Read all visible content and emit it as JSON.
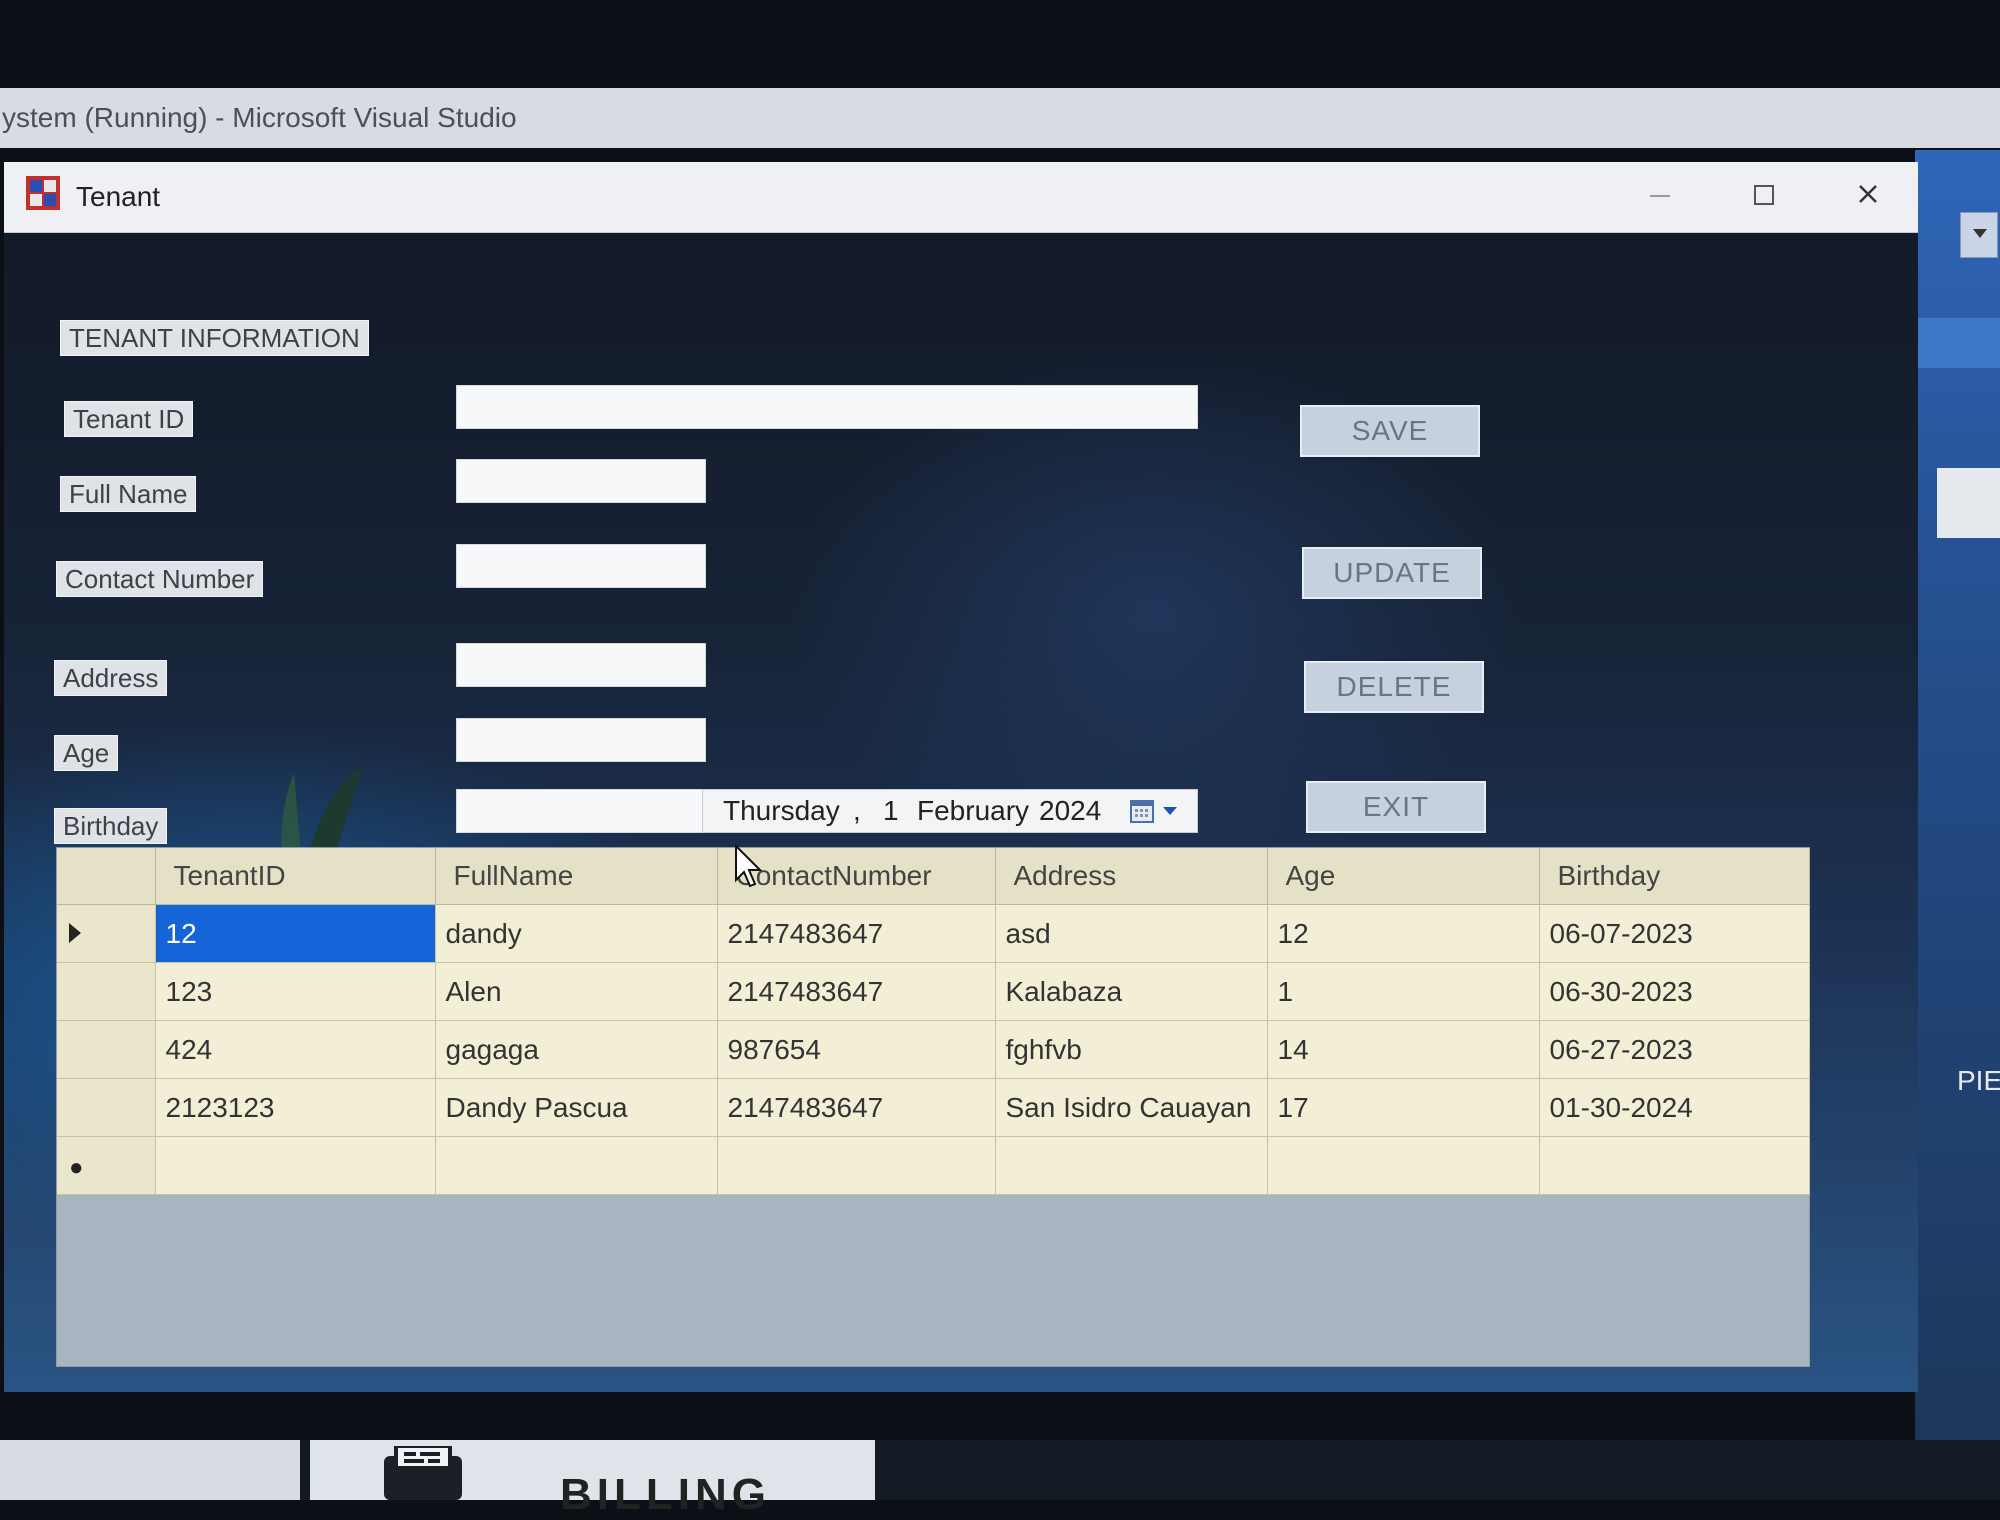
{
  "vs_titlebar": {
    "title": "ystem (Running) - Microsoft Visual Studio"
  },
  "window": {
    "title": "Tenant"
  },
  "form": {
    "section_title": "TENANT INFORMATION",
    "labels": {
      "tenant_id": "Tenant ID",
      "full_name": "Full Name",
      "contact_number": "Contact Number",
      "address": "Address",
      "age": "Age",
      "birthday": "Birthday"
    },
    "values": {
      "tenant_id": "",
      "full_name": "",
      "contact_number": "",
      "address": "",
      "age": "",
      "birthday": ""
    },
    "date_picker": {
      "weekday": "Thursday",
      "separator": ",",
      "day": "1",
      "month": "February",
      "year": "2024"
    }
  },
  "buttons": {
    "save": "SAVE",
    "update": "UPDATE",
    "delete": "DELETE",
    "exit": "EXIT"
  },
  "grid": {
    "columns": [
      "TenantID",
      "FullName",
      "ContactNumber",
      "Address",
      "Age",
      "Birthday"
    ],
    "rows": [
      {
        "TenantID": "12",
        "FullName": "dandy",
        "ContactNumber": "2147483647",
        "Address": "asd",
        "Age": "12",
        "Birthday": "06-07-2023"
      },
      {
        "TenantID": "123",
        "FullName": "Alen",
        "ContactNumber": "2147483647",
        "Address": "Kalabaza",
        "Age": "1",
        "Birthday": "06-30-2023"
      },
      {
        "TenantID": "424",
        "FullName": "gagaga",
        "ContactNumber": "987654",
        "Address": "fghfvb",
        "Age": "14",
        "Birthday": "06-27-2023"
      },
      {
        "TenantID": "2123123",
        "FullName": "Dandy Pascua",
        "ContactNumber": "2147483647",
        "Address": "San Isidro Cauayan",
        "Age": "17",
        "Birthday": "01-30-2024"
      }
    ],
    "selected_row": 0
  },
  "background_right": {
    "edge_text": "PIE"
  },
  "taskbar": {
    "billing_label": "BILLING"
  },
  "icons": [
    "app-icon",
    "minimize-icon",
    "maximize-icon",
    "close-icon",
    "calendar-icon",
    "dropdown-arrow-icon",
    "printer-icon",
    "mouse-cursor-icon",
    "plant-decoration"
  ],
  "colors": {
    "selection": "#1565d8",
    "grid_cell": "#f2efd6",
    "grid_header": "#e4e1c6",
    "button": "#c5d1df"
  }
}
